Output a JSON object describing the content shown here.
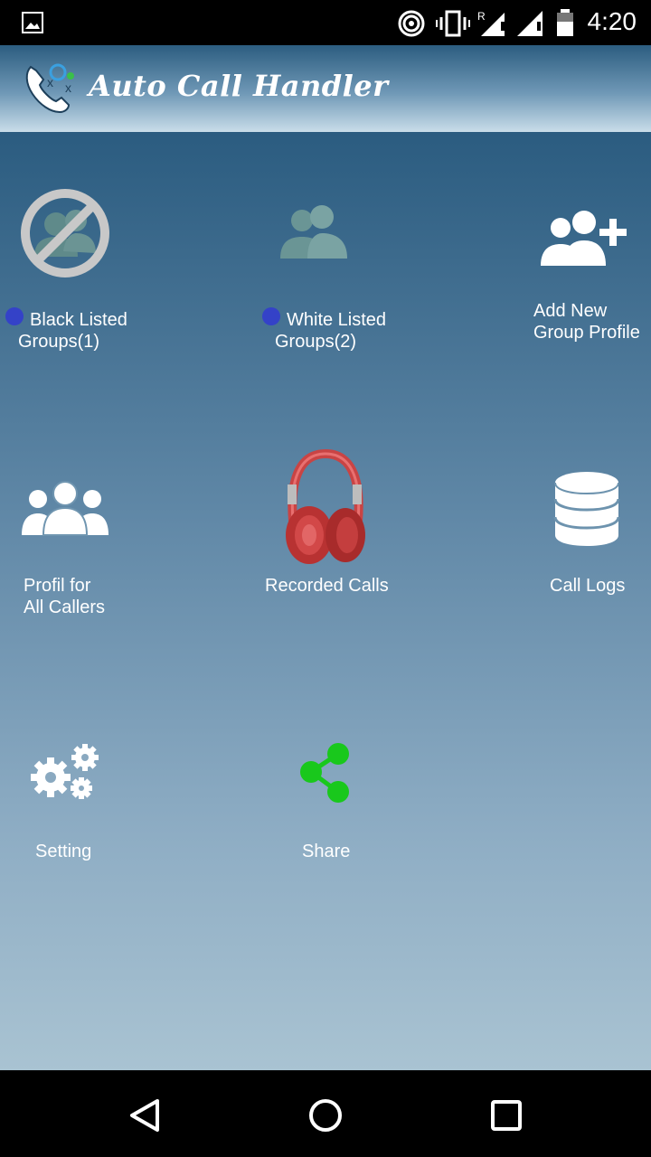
{
  "status_bar": {
    "time": "4:20"
  },
  "app_bar": {
    "title": "Auto Call Handler"
  },
  "tiles": [
    {
      "id": "black-listed",
      "label": "Black Listed\nGroups(1)"
    },
    {
      "id": "white-listed",
      "label": "White Listed\nGroups(2)"
    },
    {
      "id": "add-new-group",
      "label": "Add New\nGroup Profile"
    },
    {
      "id": "profile-all",
      "label": "Profil for\nAll Callers"
    },
    {
      "id": "recorded-calls",
      "label": "Recorded Calls"
    },
    {
      "id": "call-logs",
      "label": "Call Logs"
    },
    {
      "id": "setting",
      "label": "Setting"
    },
    {
      "id": "share",
      "label": "Share"
    }
  ],
  "icons": {
    "black_listed": "blocked-group-icon",
    "white_listed": "group-icon",
    "add_group": "add-group-icon",
    "all_callers": "people-icon",
    "recorded_calls": "headphones-icon",
    "call_logs": "database-icon",
    "setting": "gears-icon",
    "share": "share-icon"
  },
  "colors": {
    "dot": "#3442c8",
    "share": "#19c81c",
    "headphones": "#d83a3a"
  }
}
